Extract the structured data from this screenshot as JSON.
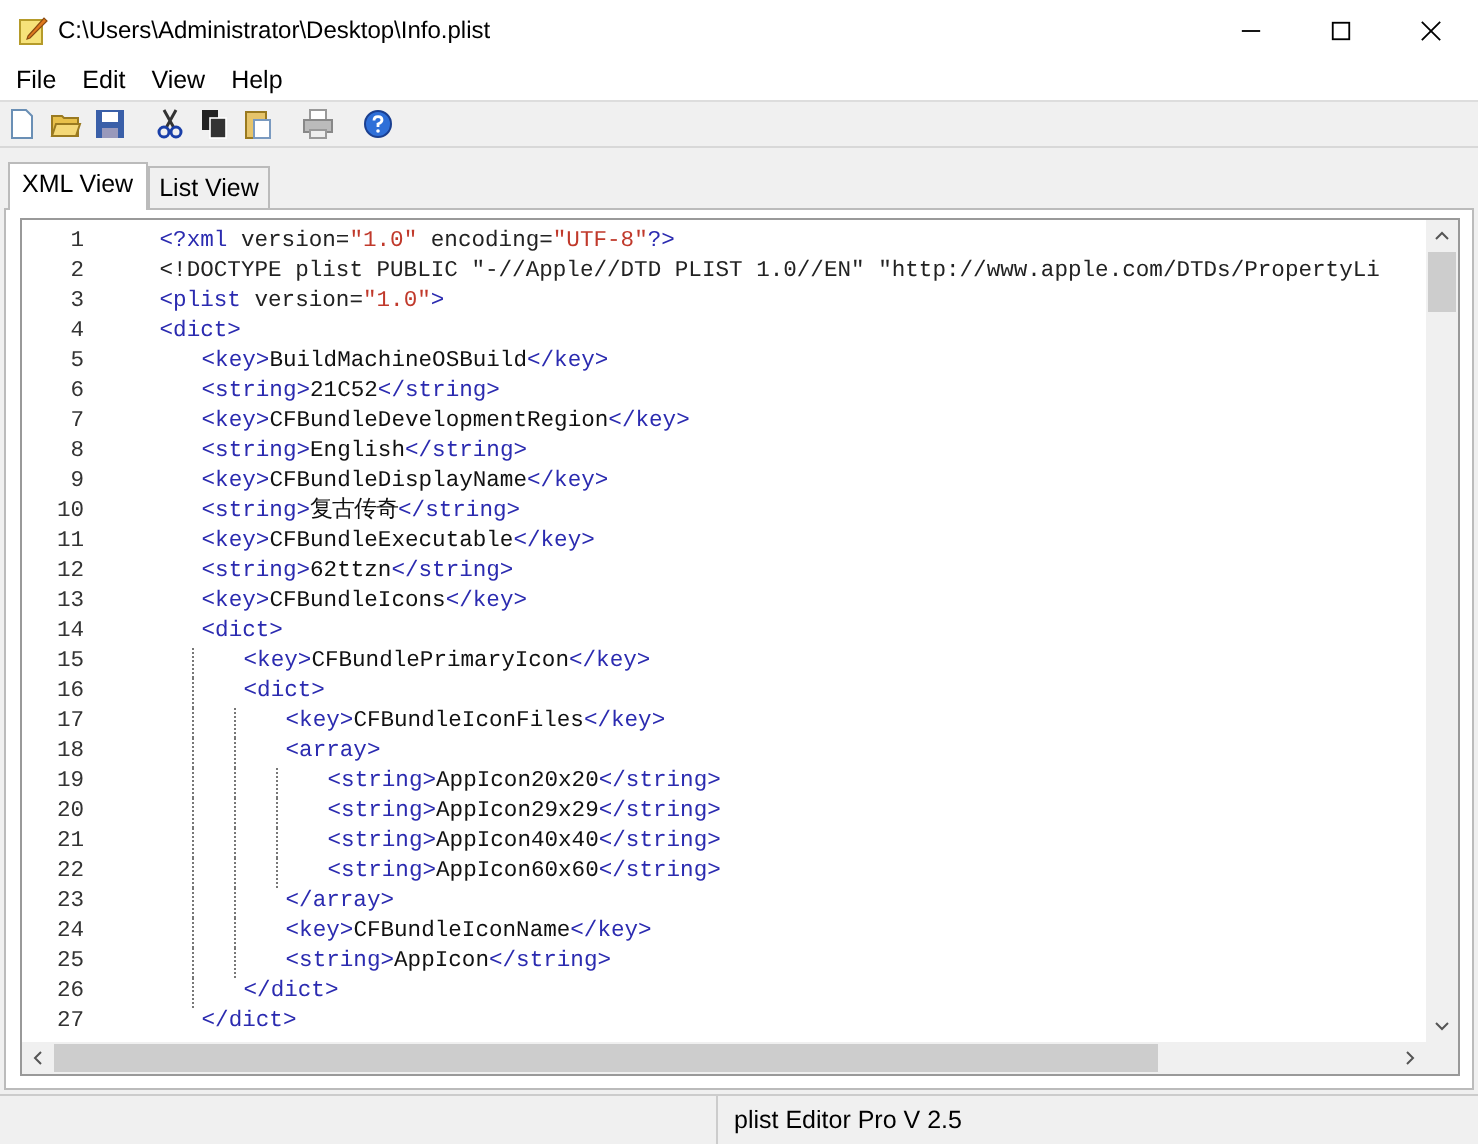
{
  "window": {
    "title": "C:\\Users\\Administrator\\Desktop\\Info.plist"
  },
  "menu": [
    "File",
    "Edit",
    "View",
    "Help"
  ],
  "toolbar": [
    {
      "kind": "new"
    },
    {
      "kind": "open"
    },
    {
      "kind": "save"
    },
    {
      "kind": "cut"
    },
    {
      "kind": "copy"
    },
    {
      "kind": "paste"
    },
    {
      "kind": "print"
    },
    {
      "kind": "help"
    }
  ],
  "tabs": [
    {
      "label": "XML View",
      "selected": true
    },
    {
      "label": "List View",
      "selected": false
    }
  ],
  "editor": {
    "lines": [
      {
        "number": "1",
        "segments": [
          {
            "kind": "tag",
            "text": "<?xml"
          },
          {
            "kind": "attr",
            "text": " version="
          },
          {
            "kind": "value",
            "text": "\"1.0\""
          },
          {
            "kind": "attr",
            "text": " encoding="
          },
          {
            "kind": "value",
            "text": "\"UTF-8\""
          },
          {
            "kind": "tag",
            "text": "?>"
          }
        ]
      },
      {
        "number": "2",
        "segments": [
          {
            "kind": "attr",
            "text": "<!DOCTYPE plist PUBLIC \"-//Apple//DTD PLIST 1.0//EN\" \"http://www.apple.com/DTDs/PropertyLi"
          }
        ]
      },
      {
        "number": "3",
        "segments": [
          {
            "kind": "tag",
            "text": "<plist"
          },
          {
            "kind": "attr",
            "text": " version="
          },
          {
            "kind": "value",
            "text": "\"1.0\""
          },
          {
            "kind": "tag",
            "text": ">"
          }
        ]
      },
      {
        "number": "4",
        "segments": [
          {
            "kind": "tag",
            "text": "<dict>"
          }
        ],
        "children": [
          {
            "number": "5",
            "segments": [
              {
                "kind": "tag",
                "text": "<key>"
              },
              {
                "kind": "text",
                "text": "BuildMachineOSBuild"
              },
              {
                "kind": "tag",
                "text": "</key>"
              }
            ]
          },
          {
            "number": "6",
            "segments": [
              {
                "kind": "tag",
                "text": "<string>"
              },
              {
                "kind": "text",
                "text": "21C52"
              },
              {
                "kind": "tag",
                "text": "</string>"
              }
            ]
          },
          {
            "number": "7",
            "segments": [
              {
                "kind": "tag",
                "text": "<key>"
              },
              {
                "kind": "text",
                "text": "CFBundleDevelopmentRegion"
              },
              {
                "kind": "tag",
                "text": "</key>"
              }
            ]
          },
          {
            "number": "8",
            "segments": [
              {
                "kind": "tag",
                "text": "<string>"
              },
              {
                "kind": "text",
                "text": "English"
              },
              {
                "kind": "tag",
                "text": "</string>"
              }
            ]
          },
          {
            "number": "9",
            "segments": [
              {
                "kind": "tag",
                "text": "<key>"
              },
              {
                "kind": "text",
                "text": "CFBundleDisplayName"
              },
              {
                "kind": "tag",
                "text": "</key>"
              }
            ]
          },
          {
            "number": "10",
            "segments": [
              {
                "kind": "tag",
                "text": "<string>"
              },
              {
                "kind": "text",
                "text": "复古传奇"
              },
              {
                "kind": "tag",
                "text": "</string>"
              }
            ]
          },
          {
            "number": "11",
            "segments": [
              {
                "kind": "tag",
                "text": "<key>"
              },
              {
                "kind": "text",
                "text": "CFBundleExecutable"
              },
              {
                "kind": "tag",
                "text": "</key>"
              }
            ]
          },
          {
            "number": "12",
            "segments": [
              {
                "kind": "tag",
                "text": "<string>"
              },
              {
                "kind": "text",
                "text": "62ttzn"
              },
              {
                "kind": "tag",
                "text": "</string>"
              }
            ]
          },
          {
            "number": "13",
            "segments": [
              {
                "kind": "tag",
                "text": "<key>"
              },
              {
                "kind": "text",
                "text": "CFBundleIcons"
              },
              {
                "kind": "tag",
                "text": "</key>"
              }
            ]
          },
          {
            "number": "14",
            "segments": [
              {
                "kind": "tag",
                "text": "<dict>"
              }
            ],
            "children": [
              {
                "number": "15",
                "segments": [
                  {
                    "kind": "tag",
                    "text": "<key>"
                  },
                  {
                    "kind": "text",
                    "text": "CFBundlePrimaryIcon"
                  },
                  {
                    "kind": "tag",
                    "text": "</key>"
                  }
                ]
              },
              {
                "number": "16",
                "segments": [
                  {
                    "kind": "tag",
                    "text": "<dict>"
                  }
                ],
                "children": [
                  {
                    "number": "17",
                    "segments": [
                      {
                        "kind": "tag",
                        "text": "<key>"
                      },
                      {
                        "kind": "text",
                        "text": "CFBundleIconFiles"
                      },
                      {
                        "kind": "tag",
                        "text": "</key>"
                      }
                    ]
                  },
                  {
                    "number": "18",
                    "segments": [
                      {
                        "kind": "tag",
                        "text": "<array>"
                      }
                    ],
                    "children": [
                      {
                        "number": "19",
                        "segments": [
                          {
                            "kind": "tag",
                            "text": "<string>"
                          },
                          {
                            "kind": "text",
                            "text": "AppIcon20x20"
                          },
                          {
                            "kind": "tag",
                            "text": "</string>"
                          }
                        ]
                      },
                      {
                        "number": "20",
                        "segments": [
                          {
                            "kind": "tag",
                            "text": "<string>"
                          },
                          {
                            "kind": "text",
                            "text": "AppIcon29x29"
                          },
                          {
                            "kind": "tag",
                            "text": "</string>"
                          }
                        ]
                      },
                      {
                        "number": "21",
                        "segments": [
                          {
                            "kind": "tag",
                            "text": "<string>"
                          },
                          {
                            "kind": "text",
                            "text": "AppIcon40x40"
                          },
                          {
                            "kind": "tag",
                            "text": "</string>"
                          }
                        ]
                      },
                      {
                        "number": "22",
                        "segments": [
                          {
                            "kind": "tag",
                            "text": "<string>"
                          },
                          {
                            "kind": "text",
                            "text": "AppIcon60x60"
                          },
                          {
                            "kind": "tag",
                            "text": "</string>"
                          }
                        ]
                      }
                    ]
                  },
                  {
                    "number": "23",
                    "segments": [
                      {
                        "kind": "tag",
                        "text": "</array>"
                      }
                    ]
                  },
                  {
                    "number": "24",
                    "segments": [
                      {
                        "kind": "tag",
                        "text": "<key>"
                      },
                      {
                        "kind": "text",
                        "text": "CFBundleIconName"
                      },
                      {
                        "kind": "tag",
                        "text": "</key>"
                      }
                    ]
                  },
                  {
                    "number": "25",
                    "segments": [
                      {
                        "kind": "tag",
                        "text": "<string>"
                      },
                      {
                        "kind": "text",
                        "text": "AppIcon"
                      },
                      {
                        "kind": "tag",
                        "text": "</string>"
                      }
                    ]
                  }
                ]
              },
              {
                "number": "26",
                "segments": [
                  {
                    "kind": "tag",
                    "text": "</dict>"
                  }
                ]
              }
            ]
          },
          {
            "number": "27",
            "segments": [
              {
                "kind": "tag",
                "text": "</dict>"
              }
            ]
          }
        ]
      }
    ]
  },
  "status_bar": {
    "text": "plist Editor Pro V 2.5"
  }
}
